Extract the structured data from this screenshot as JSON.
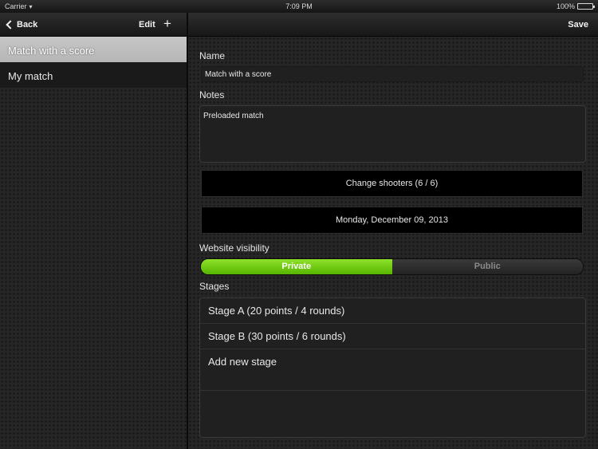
{
  "status_bar": {
    "carrier": "Carrier",
    "time": "7:09 PM",
    "battery": "100%"
  },
  "left_nav": {
    "back_label": "Back",
    "edit_label": "Edit",
    "add_label": "+"
  },
  "matches": [
    {
      "label": "Match with a score",
      "selected": true
    },
    {
      "label": "My match",
      "selected": false
    }
  ],
  "right_nav": {
    "save_label": "Save"
  },
  "form": {
    "name_label": "Name",
    "name_value": "Match with a score",
    "notes_label": "Notes",
    "notes_value": "Preloaded match",
    "shooters_button": "Change shooters (6 / 6)",
    "date_button": "Monday, December 09, 2013",
    "visibility_label": "Website visibility",
    "visibility_options": [
      "Private",
      "Public"
    ],
    "visibility_selected": "Private",
    "stages_label": "Stages",
    "stages": [
      "Stage A (20 points / 4 rounds)",
      "Stage B (30 points / 6 rounds)"
    ],
    "add_stage_label": "Add new stage"
  },
  "colors": {
    "accent_green": "#6fcb12",
    "background": "#262626"
  }
}
